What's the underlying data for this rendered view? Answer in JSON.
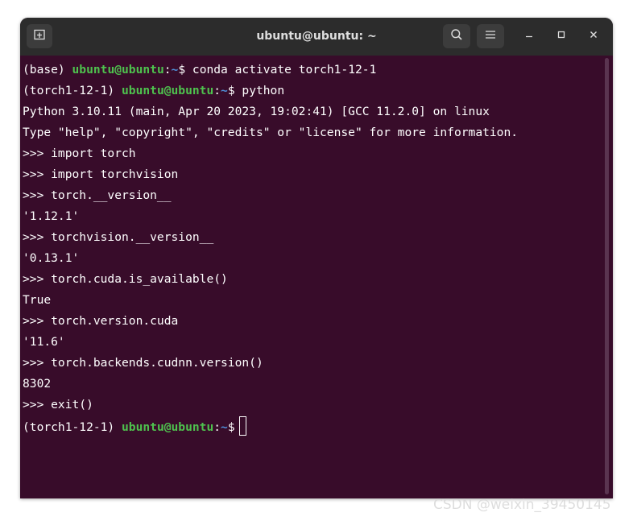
{
  "window": {
    "title": "ubuntu@ubuntu: ~",
    "new_tab_icon": "new-tab-icon",
    "search_icon": "search-icon",
    "menu_icon": "hamburger-menu-icon",
    "minimize_icon": "minimize-icon",
    "maximize_icon": "maximize-icon",
    "close_icon": "close-icon"
  },
  "colors": {
    "terminal_bg": "#380c2a",
    "titlebar_bg": "#2c2c2c",
    "prompt_user": "#4ec24e",
    "prompt_path": "#4f8fd8",
    "text": "#ffffff"
  },
  "terminal": {
    "lines": [
      {
        "pre": "(base) ",
        "user": "ubuntu@ubuntu",
        "sep": ":",
        "path": "~",
        "post": "$ conda activate torch1-12-1"
      },
      {
        "pre": "(torch1-12-1) ",
        "user": "ubuntu@ubuntu",
        "sep": ":",
        "path": "~",
        "post": "$ python"
      },
      {
        "text": "Python 3.10.11 (main, Apr 20 2023, 19:02:41) [GCC 11.2.0] on linux"
      },
      {
        "text": "Type \"help\", \"copyright\", \"credits\" or \"license\" for more information."
      },
      {
        "text": ">>> import torch"
      },
      {
        "text": ">>> import torchvision"
      },
      {
        "text": ">>> torch.__version__"
      },
      {
        "text": "'1.12.1'"
      },
      {
        "text": ">>> torchvision.__version__"
      },
      {
        "text": "'0.13.1'"
      },
      {
        "text": ">>> torch.cuda.is_available()"
      },
      {
        "text": "True"
      },
      {
        "text": ">>> torch.version.cuda"
      },
      {
        "text": "'11.6'"
      },
      {
        "text": ">>> torch.backends.cudnn.version()"
      },
      {
        "text": "8302"
      },
      {
        "text": ">>> exit()"
      },
      {
        "pre": "(torch1-12-1) ",
        "user": "ubuntu@ubuntu",
        "sep": ":",
        "path": "~",
        "post": "$"
      }
    ]
  },
  "watermark": "CSDN @weixin_39450145"
}
